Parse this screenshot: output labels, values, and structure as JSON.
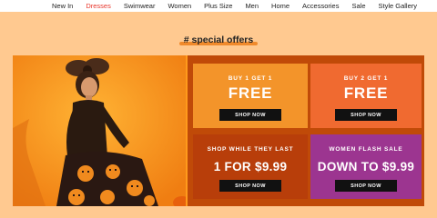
{
  "nav": {
    "items": [
      "New In",
      "Dresses",
      "Swimwear",
      "Women",
      "Plus Size",
      "Men",
      "Home",
      "Accessories",
      "Sale",
      "Style Gallery"
    ],
    "active_index": 1
  },
  "section": {
    "title": "# special offers"
  },
  "offers": [
    {
      "small": "BUY 1 GET 1",
      "big": "FREE",
      "button": "SHOP NOW"
    },
    {
      "small": "BUY 2 GET 1",
      "big": "FREE",
      "button": "SHOP NOW"
    },
    {
      "small": "SHOP WHILE THEY LAST",
      "big": "1 FOR $9.99",
      "button": "SHOP NOW"
    },
    {
      "small": "WOMEN FLASH SALE",
      "big": "DOWN TO $9.99",
      "button": "SHOP NOW"
    }
  ],
  "colors": {
    "page_bg": "#ffc990",
    "accent_red": "#e8362b",
    "tile_orange": "#f3942a",
    "tile_coral": "#f06a30",
    "tile_rust": "#b83e0a",
    "tile_purple": "#9c3590"
  }
}
